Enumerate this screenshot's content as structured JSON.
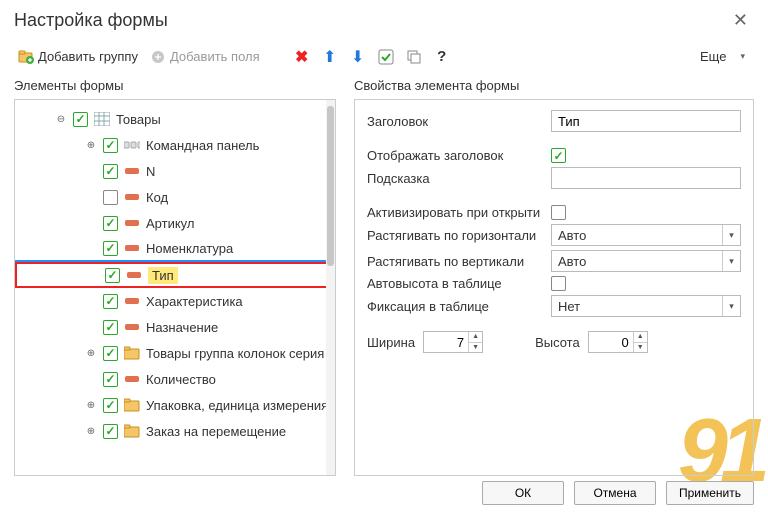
{
  "title": "Настройка формы",
  "toolbar": {
    "add_group": "Добавить группу",
    "add_fields": "Добавить поля",
    "more": "Еще"
  },
  "headers": {
    "elements": "Элементы формы",
    "properties": "Свойства элемента формы"
  },
  "tree": [
    {
      "level": 0,
      "expander": "⊖",
      "checked": true,
      "icon": "table",
      "label": "Товары"
    },
    {
      "level": 1,
      "expander": "⊕",
      "checked": true,
      "icon": "cmdpanel",
      "label": "Командная панель"
    },
    {
      "level": 1,
      "expander": "",
      "checked": true,
      "icon": "field",
      "label": "N"
    },
    {
      "level": 1,
      "expander": "",
      "checked": false,
      "icon": "field",
      "label": "Код"
    },
    {
      "level": 1,
      "expander": "",
      "checked": true,
      "icon": "field",
      "label": "Артикул"
    },
    {
      "level": 1,
      "expander": "",
      "checked": true,
      "icon": "field",
      "label": "Номенклатура",
      "class": "nomen-underline"
    },
    {
      "level": 1,
      "expander": "",
      "checked": true,
      "icon": "field",
      "label": "Тип",
      "selected": true
    },
    {
      "level": 1,
      "expander": "",
      "checked": true,
      "icon": "field",
      "label": "Характеристика"
    },
    {
      "level": 1,
      "expander": "",
      "checked": true,
      "icon": "field",
      "label": "Назначение"
    },
    {
      "level": 1,
      "expander": "⊕",
      "checked": true,
      "icon": "folder",
      "label": "Товары группа колонок серия"
    },
    {
      "level": 1,
      "expander": "",
      "checked": true,
      "icon": "field",
      "label": "Количество"
    },
    {
      "level": 1,
      "expander": "⊕",
      "checked": true,
      "icon": "folder",
      "label": "Упаковка, единица измерения"
    },
    {
      "level": 1,
      "expander": "⊕",
      "checked": true,
      "icon": "folder",
      "label": "Заказ на перемещение"
    }
  ],
  "props": {
    "title_label": "Заголовок",
    "title_value": "Тип",
    "show_title_label": "Отображать заголовок",
    "show_title_checked": true,
    "tooltip_label": "Подсказка",
    "tooltip_value": "",
    "activate_label": "Активизировать при открыти",
    "activate_checked": false,
    "stretch_h_label": "Растягивать по горизонтали",
    "stretch_h_value": "Авто",
    "stretch_v_label": "Растягивать по вертикали",
    "stretch_v_value": "Авто",
    "autoheight_label": "Автовысота в таблице",
    "autoheight_checked": false,
    "fixation_label": "Фиксация в таблице",
    "fixation_value": "Нет",
    "width_label": "Ширина",
    "width_value": "7",
    "height_label": "Высота",
    "height_value": "0"
  },
  "buttons": {
    "ok": "ОК",
    "cancel": "Отмена",
    "apply": "Применить"
  }
}
